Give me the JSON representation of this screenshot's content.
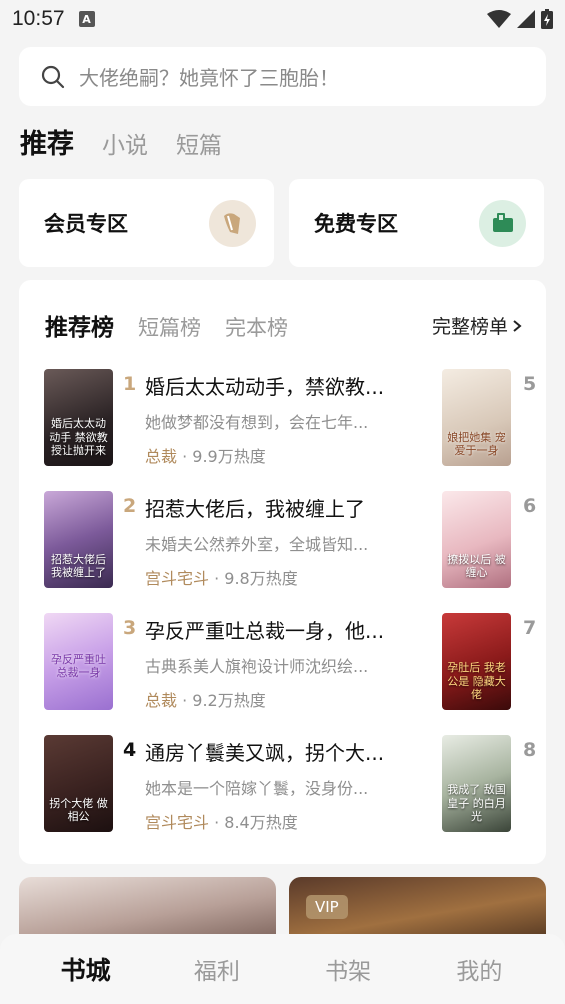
{
  "status_bar": {
    "time": "10:57",
    "notification_icon": "A"
  },
  "search": {
    "placeholder": "大佬绝嗣？她竟怀了三胞胎！"
  },
  "tabs": [
    {
      "label": "推荐",
      "active": true
    },
    {
      "label": "小说",
      "active": false
    },
    {
      "label": "短篇",
      "active": false
    }
  ],
  "zones": [
    {
      "label": "会员专区",
      "icon": "vip-scroll-icon"
    },
    {
      "label": "免费专区",
      "icon": "free-book-icon"
    }
  ],
  "ranking": {
    "tabs": [
      {
        "label": "推荐榜",
        "active": true
      },
      {
        "label": "短篇榜",
        "active": false
      },
      {
        "label": "完本榜",
        "active": false
      }
    ],
    "full_list_label": "完整榜单",
    "books": [
      {
        "rank": "1",
        "title": "婚后太太动动手，禁欲教...",
        "desc": "她做梦都没有想到，会在七年...",
        "category": "总裁",
        "heat": "· 9.9万热度",
        "cover_text": "婚后太太动动手 禁欲教授让抛开来"
      },
      {
        "rank": "2",
        "title": "招惹大佬后，我被缠上了",
        "desc": "未婚夫公然养外室，全城皆知...",
        "category": "宫斗宅斗",
        "heat": "· 9.8万热度",
        "cover_text": "招惹大佬后 我被缠上了"
      },
      {
        "rank": "3",
        "title": "孕反严重吐总裁一身，他...",
        "desc": "古典系美人旗袍设计师沈织绘...",
        "category": "总裁",
        "heat": "· 9.2万热度",
        "cover_text": "孕反严重吐总裁一身"
      },
      {
        "rank": "4",
        "title": "通房丫鬟美又飒，拐个大...",
        "desc": "她本是一个陪嫁丫鬟，没身份...",
        "category": "宫斗宅斗",
        "heat": "· 8.4万热度",
        "cover_text": "拐个大佬 做相公"
      }
    ],
    "side_books": [
      {
        "rank": "5",
        "cover_text": "娘把她集 宠爱于一身"
      },
      {
        "rank": "6",
        "cover_text": "撩拨以后 被缠心"
      },
      {
        "rank": "7",
        "cover_text": "孕肚后 我老公是 隐藏大佬"
      },
      {
        "rank": "8",
        "cover_text": "我成了 敌国皇子 的白月光"
      }
    ]
  },
  "banners": [
    {
      "vip": ""
    },
    {
      "vip": "VIP"
    }
  ],
  "bottom_nav": [
    {
      "label": "书城",
      "active": true
    },
    {
      "label": "福利",
      "active": false
    },
    {
      "label": "书架",
      "active": false
    },
    {
      "label": "我的",
      "active": false
    }
  ]
}
